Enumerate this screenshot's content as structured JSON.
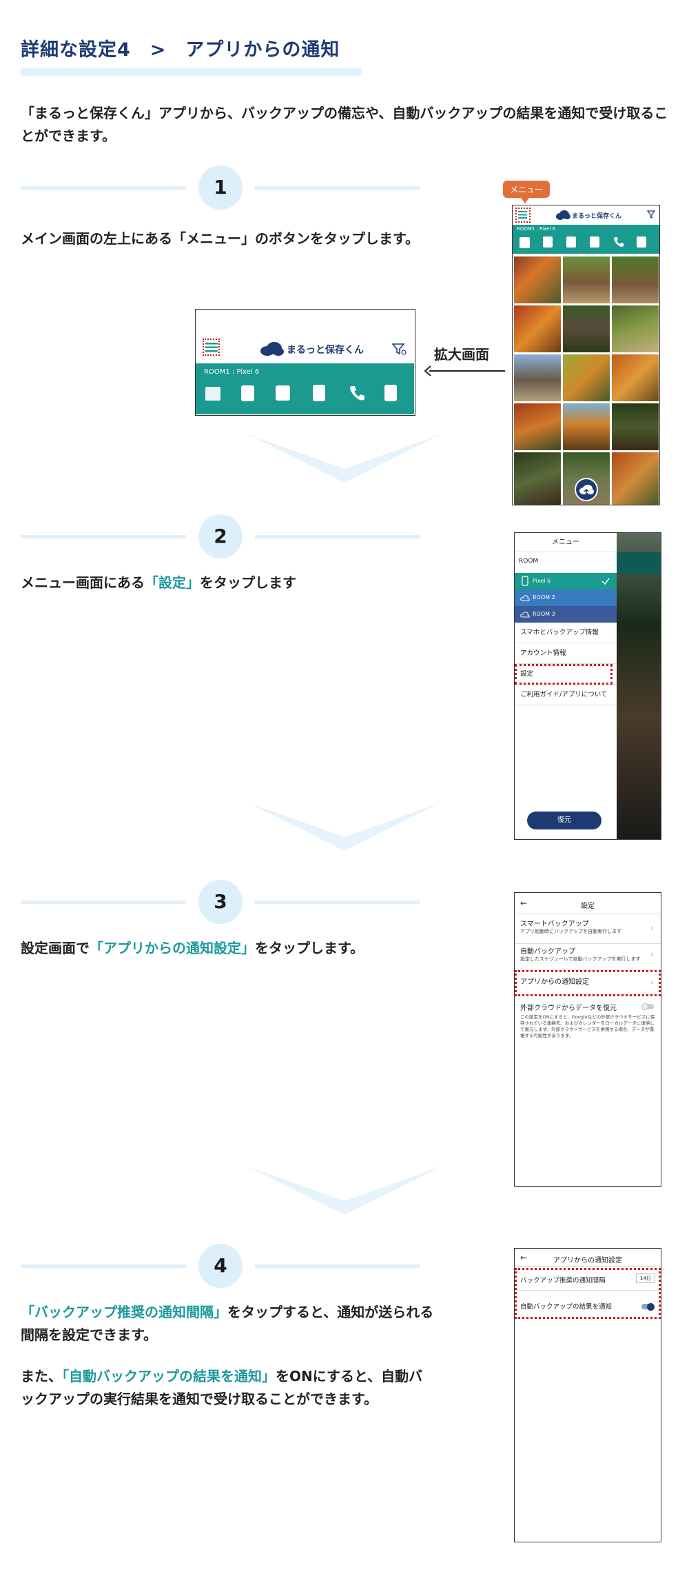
{
  "header": {
    "title": "詳細な設定4　>　アプリからの通知",
    "intro": "「まるっと保存くん」アプリから、バックアップの備忘や、自動バックアップの結果を通知で受け取ることができます。"
  },
  "colors": {
    "navy": "#1d3a73",
    "teal": "#1b9a8f",
    "highlight": "#1b9a9c",
    "red": "#d3141f",
    "orange": "#e0703a"
  },
  "step1": {
    "number": "1",
    "text": "メイン画面の左上にある「メニュー」のボタンをタップします。",
    "callout": "メニュー",
    "zoom_label": "拡大画面",
    "app_title": "まるっと保存くん",
    "room_label": "ROOM1 : Pixel 6",
    "toolbar_icons": [
      "gallery-icon",
      "contacts-icon",
      "calendar-icon",
      "music-icon",
      "phone-icon",
      "document-icon"
    ]
  },
  "step2": {
    "number": "2",
    "text_pre": "メニュー画面にある",
    "text_hl": "「設定」",
    "text_post": "をタップします",
    "menu_title": "メニュー",
    "room_header": "ROOM",
    "rooms": [
      "Pixel 6",
      "ROOM 2",
      "ROOM 3"
    ],
    "items": [
      "スマホとバックアップ情報",
      "アカウント情報",
      "設定",
      "ご利用ガイド/アプリについて"
    ],
    "restore_button": "復元"
  },
  "step3": {
    "number": "3",
    "text_pre": "設定画面で",
    "text_hl": "「アプリからの通知設定」",
    "text_post": "をタップします。",
    "screen_title": "設定",
    "items": [
      {
        "title": "スマートバックアップ",
        "desc": "アプリ起動時にバックアップを自動実行します"
      },
      {
        "title": "自動バックアップ",
        "desc": "設定したスケジュールで自動バックアップを実行します"
      },
      {
        "title": "アプリからの通知設定",
        "desc": ""
      }
    ],
    "cloud_title": "外部クラウドからデータを復元",
    "cloud_desc": "この設定をONにすると、Googleなどの外部クラウドサービスに保存されている連絡先、およびカレンダーをローカルデータに復帰して復元します。外部クラウドサービスを併用する場合、データが重複する可能性があります。"
  },
  "step4": {
    "number": "4",
    "para1_hl": "「バックアップ推奨の通知間隔」",
    "para1_post": "をタップすると、通知が送られる間隔を設定できます。",
    "para2_pre": "また、",
    "para2_hl": "「自動バックアップの結果を通知」",
    "para2_post": "をONにすると、自動バックアップの実行結果を通知で受け取ることができます。",
    "screen_title": "アプリからの通知設定",
    "interval_label": "バックアップ推奨の通知間隔",
    "interval_value": "14日",
    "result_label": "自動バックアップの結果を通知"
  }
}
